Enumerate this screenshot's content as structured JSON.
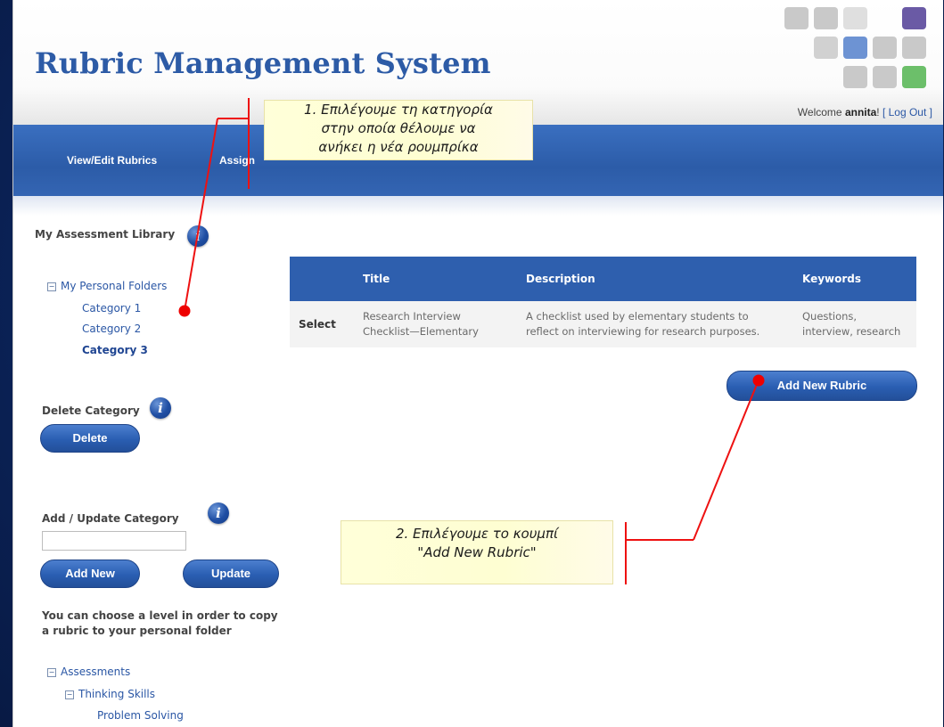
{
  "app": {
    "title": "Rubric Management System"
  },
  "header": {
    "welcome_prefix": "Welcome ",
    "username": "annita",
    "welcome_suffix": "! ",
    "logout": "[ Log Out ]"
  },
  "nav": {
    "items": [
      {
        "label": "View/Edit Rubrics"
      },
      {
        "label": "Assign"
      }
    ]
  },
  "sidebar": {
    "library_heading": "My Assessment Library",
    "personal_folders": "My Personal Folders",
    "categories": [
      "Category 1",
      "Category 2",
      "Category 3"
    ],
    "delete_heading": "Delete Category",
    "delete_button": "Delete",
    "add_update_heading": "Add / Update Category",
    "category_input_value": "",
    "add_new_button": "Add New",
    "update_button": "Update",
    "copy_note_line1": "You can choose a level in order to copy",
    "copy_note_line2": "a rubric to your personal folder",
    "tree": {
      "root": "Assessments",
      "child": "Thinking Skills",
      "leaf": "Problem Solving"
    }
  },
  "table": {
    "headers": [
      "",
      "Title",
      "Description",
      "Keywords"
    ],
    "rows": [
      {
        "select": "Select",
        "title_line1": "Research Interview",
        "title_line2": "Checklist—Elementary",
        "desc_line1": "A checklist used by elementary students to",
        "desc_line2": "reflect on interviewing for research purposes.",
        "kw_line1": "Questions,",
        "kw_line2": "interview, research"
      }
    ]
  },
  "add_rubric_button": "Add New Rubric",
  "callouts": {
    "step1_line1": "1. Επιλέγουμε τη κατηγορία",
    "step1_line2": "στην οποία θέλουμε να",
    "step1_line3": "ανήκει η νέα ρουμπρίκα",
    "step2_line1": "2. Επιλέγουμε το κουμπί",
    "step2_line2": "\"Add New Rubric\""
  },
  "colors": {
    "brand_blue": "#2d5ba6",
    "nav_blue": "#2c5ca8",
    "annotation_red": "#e00000",
    "callout_yellow": "#ffffd9"
  },
  "icons": {
    "info": "info-icon",
    "expander": "tree-expander-icon",
    "logo": "tile-grid-logo"
  }
}
